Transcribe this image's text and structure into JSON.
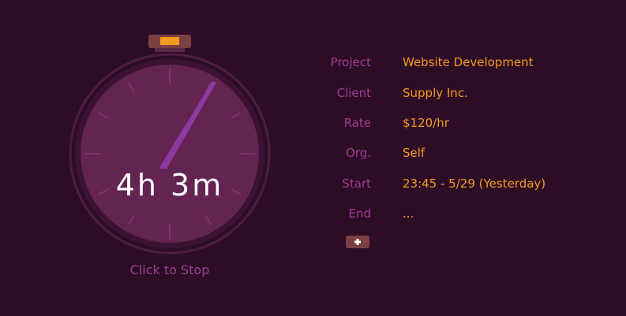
{
  "timer": {
    "elapsed": "4h 3m",
    "stop_label": "Click to Stop"
  },
  "details": [
    {
      "label": "Project",
      "value": "Website Development"
    },
    {
      "label": "Client",
      "value": "Supply Inc."
    },
    {
      "label": "Rate",
      "value": "$120/hr"
    },
    {
      "label": "Org.",
      "value": "Self"
    },
    {
      "label": "Start",
      "value": "23:45 - 5/29 (Yesterday)"
    },
    {
      "label": "End",
      "value": "..."
    }
  ],
  "colors": {
    "background": "#2d0d26",
    "label": "#a03c97",
    "value": "#f39a1f",
    "dial_face": "#632452",
    "hand": "#8a3aa0",
    "button": "#7c3f42"
  },
  "icons": {
    "add_button": "plus-icon",
    "stopwatch_button": "stopwatch-top-button"
  }
}
